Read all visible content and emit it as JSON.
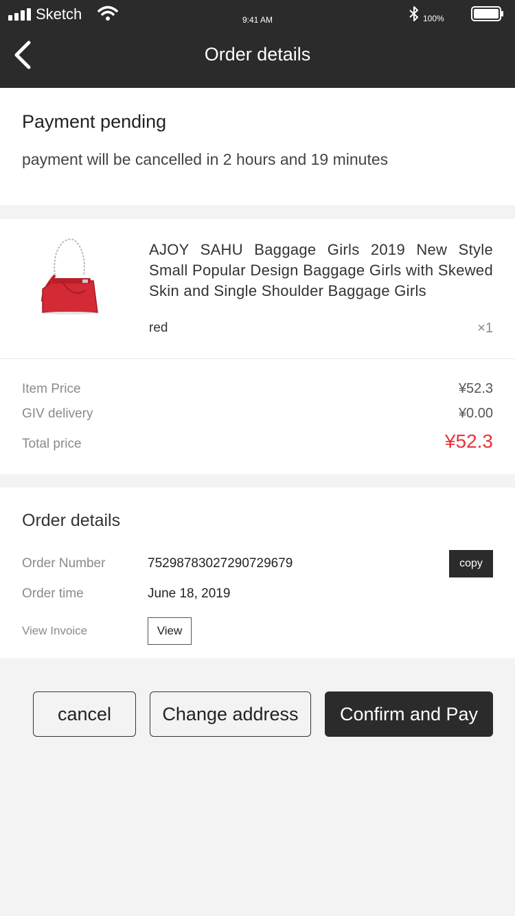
{
  "status_bar": {
    "carrier": "Sketch",
    "time": "9:41 AM",
    "battery": "100%"
  },
  "nav": {
    "title": "Order details",
    "back_icon": "chevron-left-icon"
  },
  "payment_status": {
    "title": "Payment pending",
    "message": "payment will be cancelled in 2 hours and 19 minutes"
  },
  "product": {
    "name": "AJOY SAHU Baggage Girls 2019 New Style Small Popular Design Baggage Girls with Skewed Skin and Single Shoulder Baggage Girls",
    "variant": "red",
    "quantity": "×1",
    "image": "red-shoulder-bag"
  },
  "pricing": {
    "item_price_label": "Item Price",
    "item_price": "¥52.3",
    "delivery_label": "GIV delivery",
    "delivery": "¥0.00",
    "total_label": "Total price",
    "total": "¥52.3"
  },
  "order": {
    "title": "Order details",
    "number_label": "Order Number",
    "number": "7529878302729072967​9",
    "copy_label": "copy",
    "time_label": "Order time",
    "time": "June 18, 2019",
    "invoice_label": "View Invoice",
    "view_label": "View"
  },
  "actions": {
    "cancel": "cancel",
    "change_address": "Change address",
    "confirm_pay": "Confirm and Pay"
  },
  "colors": {
    "header_bg": "#2b2b2b",
    "accent_red": "#e8333c",
    "page_bg": "#f3f3f3"
  }
}
